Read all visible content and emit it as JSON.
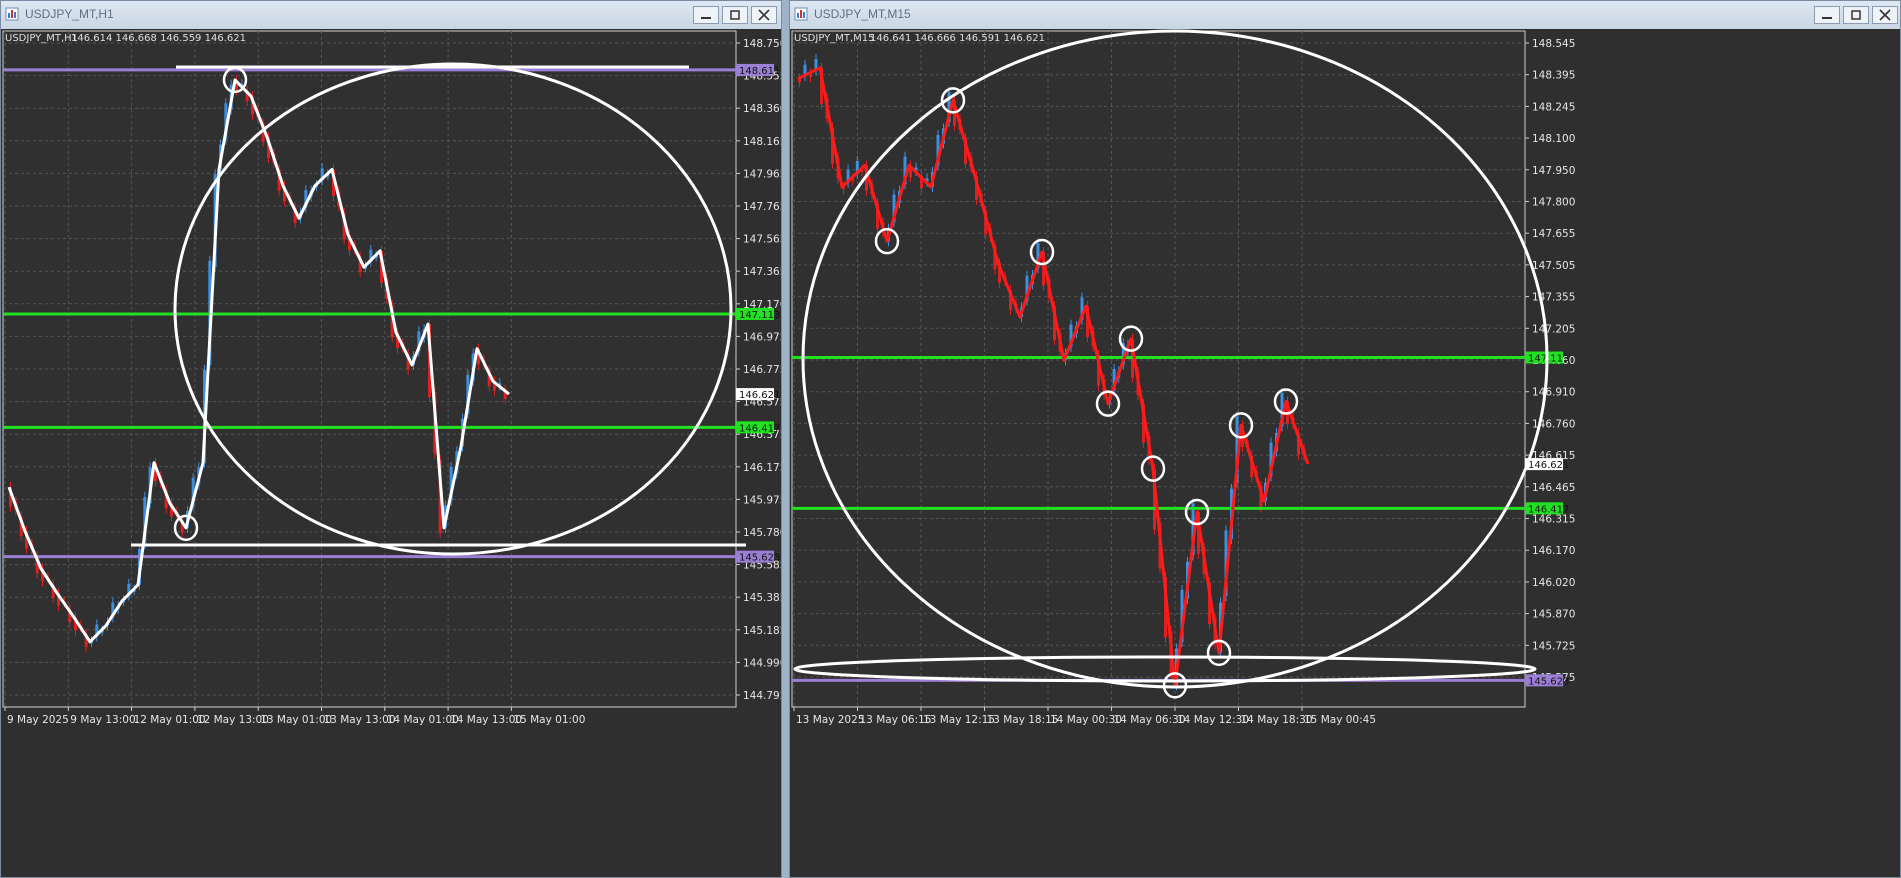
{
  "left": {
    "window_title": "USDJPY_MT,H1",
    "info_symbol": "USDJPY_MT,H1",
    "info_ohlc": "146.614 146.668 146.559 146.621",
    "price_ticks": [
      "148.750",
      "148.555",
      "148.360",
      "148.165",
      "147.965",
      "147.765",
      "147.565",
      "147.365",
      "147.170",
      "146.975",
      "146.775",
      "146.575",
      "146.375",
      "146.175",
      "145.975",
      "145.780",
      "145.585",
      "145.385",
      "145.185",
      "144.990",
      "144.795"
    ],
    "time_ticks": [
      "9 May 2025",
      "9 May 13:00",
      "12 May 01:00",
      "12 May 13:00",
      "13 May 01:00",
      "13 May 13:00",
      "14 May 01:00",
      "14 May 13:00",
      "15 May 01:00"
    ],
    "hlines": [
      {
        "label": "148.611",
        "price": 148.611,
        "color": "#9b7fd4"
      },
      {
        "label": "147.113",
        "price": 147.113,
        "color": "#22e022"
      },
      {
        "label": "146.417",
        "price": 146.417,
        "color": "#22e022"
      },
      {
        "label": "145.623",
        "price": 145.623,
        "color": "#9b7fd4"
      }
    ],
    "current_price_label": "146.621"
  },
  "right": {
    "window_title": "USDJPY_MT,M15",
    "info_symbol": "USDJPY_MT,M15",
    "info_ohlc": "146.641 146.666 146.591 146.621",
    "price_ticks": [
      "148.545",
      "148.395",
      "148.245",
      "148.100",
      "147.950",
      "147.800",
      "147.655",
      "147.505",
      "147.355",
      "147.205",
      "147.060",
      "146.910",
      "146.760",
      "146.615",
      "146.465",
      "146.315",
      "146.170",
      "146.020",
      "145.870",
      "145.725",
      "145.575"
    ],
    "time_ticks": [
      "13 May 2025",
      "13 May 06:15",
      "13 May 12:15",
      "13 May 18:15",
      "14 May 00:30",
      "14 May 06:30",
      "14 May 12:30",
      "14 May 18:30",
      "15 May 00:45"
    ],
    "hlines": [
      {
        "label": "147.113",
        "price": 147.113,
        "color": "#22e022"
      },
      {
        "label": "146.417",
        "price": 146.417,
        "color": "#22e022"
      },
      {
        "label": "145.623",
        "price": 145.623,
        "color": "#9b7fd4"
      }
    ],
    "current_price_label": "146.621"
  },
  "chart_data": [
    {
      "type": "line",
      "title": "USDJPY_MT,H1",
      "x": [
        "9 May 2025",
        "9 May 13:00",
        "12 May 01:00",
        "12 May 13:00",
        "13 May 01:00",
        "13 May 13:00",
        "14 May 01:00",
        "14 May 13:00",
        "15 May 01:00"
      ],
      "ylim": [
        144.7,
        148.85
      ],
      "series": [
        {
          "values": [
            146.05,
            145.78,
            145.55,
            145.4,
            145.25,
            145.1,
            145.2,
            145.35,
            145.45,
            146.2,
            145.95,
            145.8,
            146.2,
            148.0,
            148.55,
            148.45,
            148.2,
            147.9,
            147.7,
            147.9,
            148.0,
            147.6,
            147.4,
            147.5,
            147.0,
            146.8,
            147.05,
            145.8,
            146.3,
            146.9,
            146.7,
            146.621
          ]
        }
      ],
      "annotations": [
        "ellipse",
        "swing path",
        "circles at swing points"
      ],
      "grid": true
    },
    {
      "type": "line",
      "title": "USDJPY_MT,M15",
      "x": [
        "13 May 2025",
        "13 May 06:15",
        "13 May 12:15",
        "13 May 18:15",
        "14 May 00:30",
        "14 May 06:30",
        "14 May 12:30",
        "14 May 18:30",
        "15 May 00:45"
      ],
      "ylim": [
        145.5,
        148.62
      ],
      "series": [
        {
          "values": [
            148.4,
            148.45,
            147.9,
            148.0,
            147.65,
            148.0,
            147.9,
            148.3,
            147.95,
            147.55,
            147.3,
            147.6,
            147.1,
            147.35,
            146.9,
            147.2,
            146.6,
            145.6,
            146.4,
            145.75,
            146.8,
            146.45,
            146.91,
            146.621
          ]
        }
      ],
      "annotations": [
        "ellipse",
        "swing path",
        "circles at swing points"
      ],
      "grid": true
    }
  ]
}
